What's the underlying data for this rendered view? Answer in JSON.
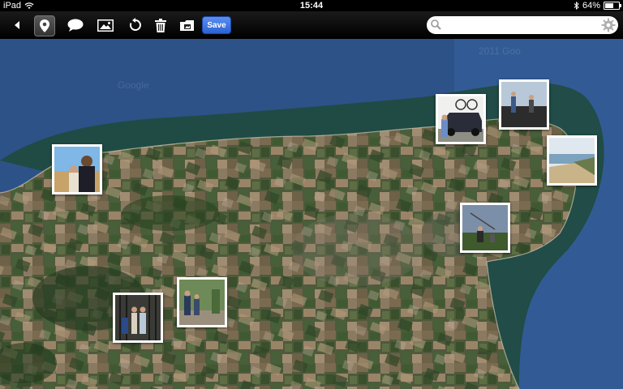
{
  "status_bar": {
    "device": "iPad",
    "time": "15:44",
    "battery": "64%",
    "battery_level": 0.64
  },
  "toolbar": {
    "save_label": "Save",
    "search_placeholder": ""
  },
  "map": {
    "watermark_left": "Google",
    "watermark_right": "2011 Goo"
  },
  "photos": [
    {
      "name": "photo-beach-couple"
    },
    {
      "name": "photo-car-bikes"
    },
    {
      "name": "photo-people-rooftop"
    },
    {
      "name": "photo-cliff-beach"
    },
    {
      "name": "photo-people-park"
    },
    {
      "name": "photo-family-garden"
    },
    {
      "name": "photo-two-people-gate"
    }
  ],
  "colors": {
    "accent_save": "#2a62d6",
    "sea": "#2b4f86"
  }
}
